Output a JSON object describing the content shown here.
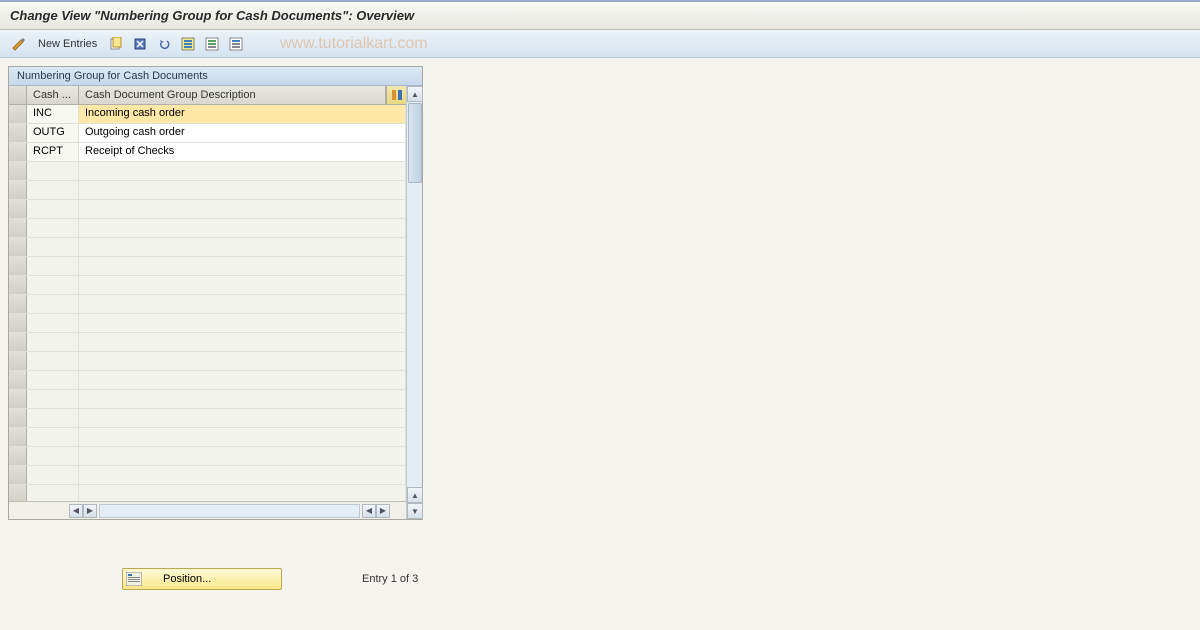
{
  "title": "Change View \"Numbering Group for Cash Documents\": Overview",
  "toolbar": {
    "new_entries_label": "New Entries"
  },
  "watermark": "www.tutorialkart.com",
  "table": {
    "title": "Numbering Group for Cash Documents",
    "columns": {
      "cash": "Cash ...",
      "description": "Cash Document Group Description"
    },
    "rows": [
      {
        "cash": "INC",
        "description": "Incoming cash order",
        "selected": true
      },
      {
        "cash": "OUTG",
        "description": "Outgoing cash order",
        "selected": false
      },
      {
        "cash": "RCPT",
        "description": "Receipt of Checks",
        "selected": false
      }
    ],
    "empty_rows": 18
  },
  "footer": {
    "position_label": "Position...",
    "entry_status": "Entry 1 of 3"
  }
}
